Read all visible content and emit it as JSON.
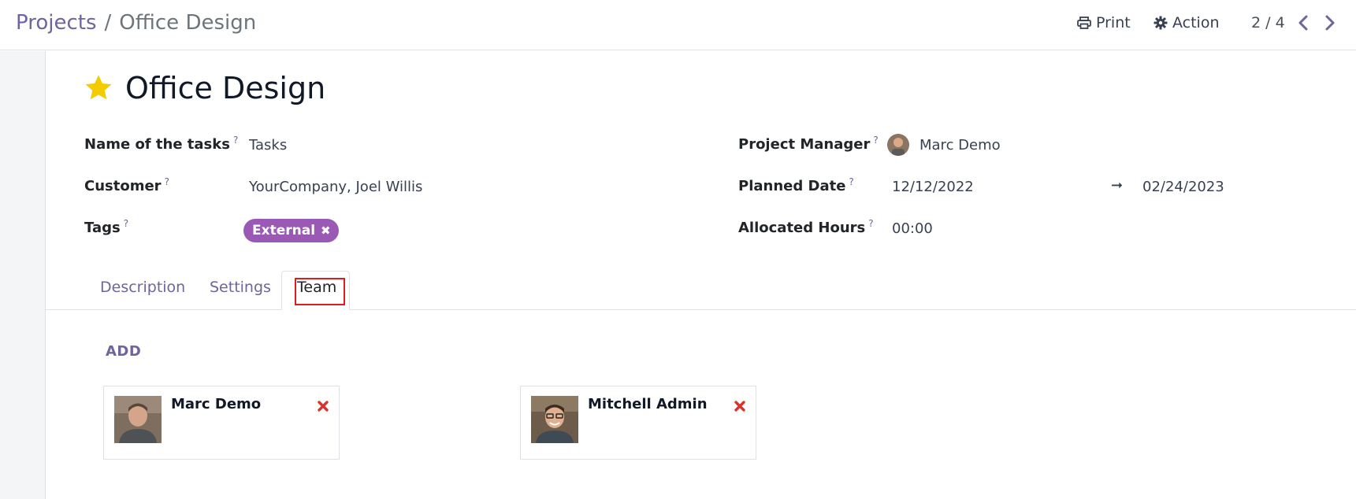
{
  "breadcrumb": {
    "parent": "Projects",
    "separator": "/",
    "current": "Office Design"
  },
  "toolbar": {
    "print_label": "Print",
    "action_label": "Action",
    "pager_value": "2 / 4"
  },
  "form": {
    "title": "Office Design",
    "favorite": true,
    "left_fields": [
      {
        "label": "Name of the tasks",
        "help": "?",
        "value": "Tasks"
      },
      {
        "label": "Customer",
        "help": "?",
        "value": "YourCompany, Joel Willis"
      },
      {
        "label": "Tags",
        "help": "?"
      }
    ],
    "tags": [
      {
        "label": "External",
        "remove_glyph": "✖",
        "color": "#9b59b6"
      }
    ],
    "right_fields": [
      {
        "label": "Project Manager",
        "help": "?",
        "value": "Marc Demo"
      },
      {
        "label": "Planned Date",
        "help": "?",
        "start": "12/12/2022",
        "arrow": "➞",
        "end": "02/24/2023"
      },
      {
        "label": "Allocated Hours",
        "help": "?",
        "value": "00:00"
      }
    ]
  },
  "tabs": [
    {
      "label": "Description",
      "active": false
    },
    {
      "label": "Settings",
      "active": false
    },
    {
      "label": "Team",
      "active": true
    }
  ],
  "team": {
    "add_label": "ADD",
    "members": [
      {
        "name": "Marc Demo",
        "avatar": "person-photo-icon"
      },
      {
        "name": "Mitchell Admin",
        "avatar": "person-photo-icon"
      }
    ]
  },
  "colors": {
    "accent": "#71639e",
    "tag": "#9b59b6",
    "star": "#f3cc00",
    "remove": "#d9342b",
    "highlight": "#e01b1b"
  }
}
